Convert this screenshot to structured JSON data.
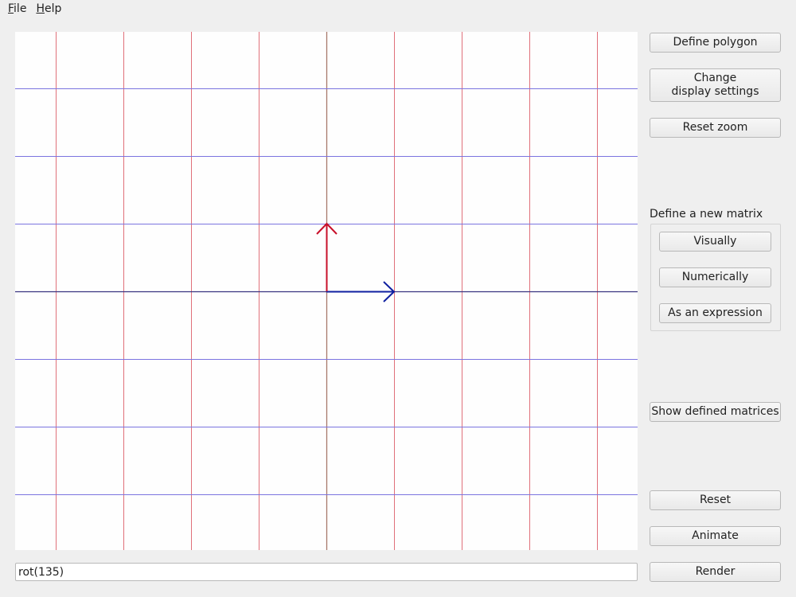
{
  "menubar": {
    "file": {
      "mnemonic": "F",
      "rest": "ile"
    },
    "help": {
      "mnemonic": "H",
      "rest": "elp"
    }
  },
  "sidebar": {
    "define_polygon": "Define polygon",
    "change_display": "Change\ndisplay settings",
    "reset_zoom": "Reset zoom",
    "matrix_group_title": "Define a new matrix",
    "visually": "Visually",
    "numerically": "Numerically",
    "as_expression": "As an expression",
    "show_defined": "Show defined matrices",
    "reset": "Reset",
    "animate": "Animate",
    "render": "Render"
  },
  "expression": {
    "value": "rot(135)"
  },
  "colors": {
    "vertical_grid": "#e0707a",
    "horizontal_grid": "#7b74e0",
    "i_hat": "#0f1fa0",
    "j_hat": "#c8102a",
    "axis_vertical": "#a8786a",
    "axis_horizontal": "#3a3480"
  }
}
